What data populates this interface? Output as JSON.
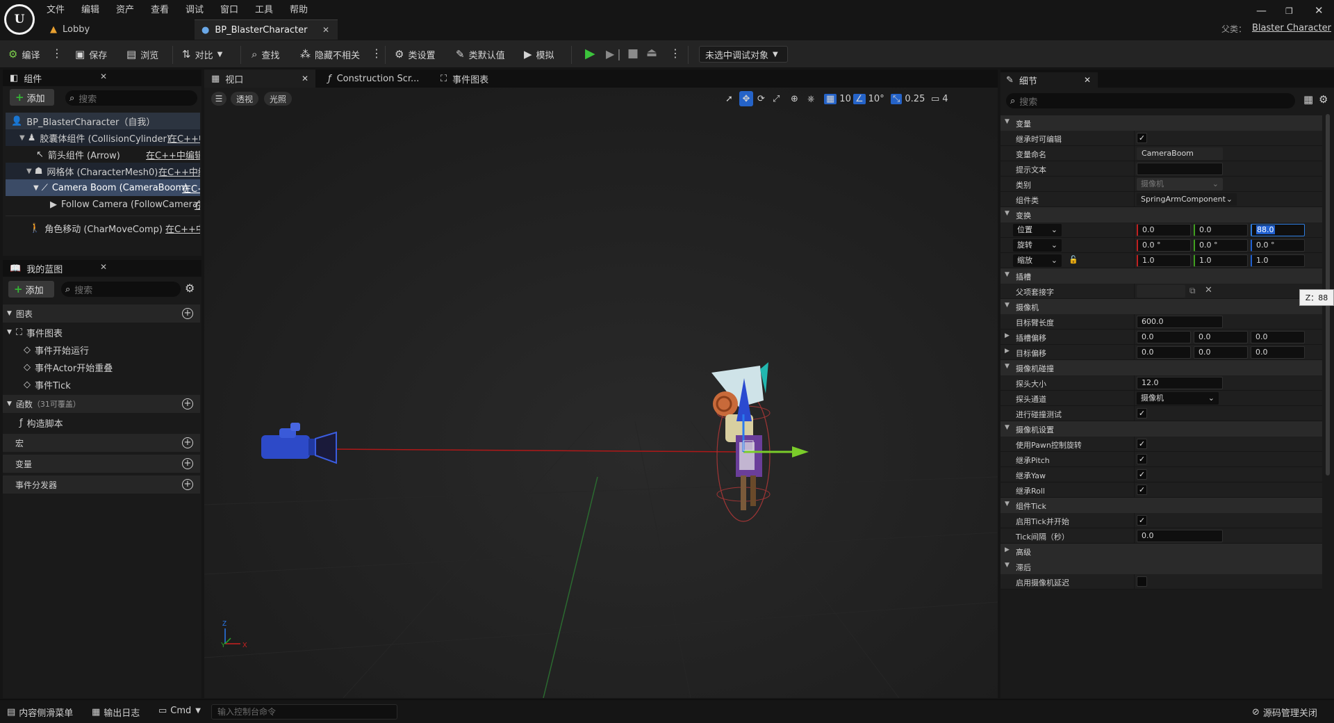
{
  "menu": [
    "文件",
    "编辑",
    "资产",
    "查看",
    "调试",
    "窗口",
    "工具",
    "帮助"
  ],
  "window_controls": {
    "minimize": "—",
    "restore": "❐",
    "close": "✕"
  },
  "tabs": [
    {
      "label": "Lobby"
    },
    {
      "label": "BP_BlasterCharacter"
    }
  ],
  "parent_class": {
    "label": "父类：",
    "value": "Blaster Character"
  },
  "toolbar": {
    "compile": "编译",
    "save": "保存",
    "browse": "浏览",
    "diff": "对比",
    "find": "查找",
    "hide_unrelated": "隐藏不相关",
    "class_settings": "类设置",
    "class_defaults": "类默认值",
    "simulate": "模拟",
    "debug_target": "未选中调试对象"
  },
  "components": {
    "title": "组件",
    "add": "添加",
    "search_placeholder": "搜索",
    "items": [
      {
        "label": "BP_BlasterCharacter（自我）"
      },
      {
        "label": "胶囊体组件 (CollisionCylinder)",
        "link": "在C++中"
      },
      {
        "label": "箭头组件 (Arrow)",
        "link": "在C++中编辑"
      },
      {
        "label": "网格体 (CharacterMesh0)",
        "link": "在C++中编"
      },
      {
        "label": "Camera Boom (CameraBoom)",
        "link": "在C+"
      },
      {
        "label": "Follow Camera (FollowCamera)",
        "link": "在"
      },
      {
        "label": "角色移动 (CharMoveComp)",
        "link": "在C++中编"
      }
    ]
  },
  "my_blueprint": {
    "title": "我的蓝图",
    "add": "添加",
    "search_placeholder": "搜索",
    "graphs": "图表",
    "event_graph": "事件图表",
    "events": [
      "事件开始运行",
      "事件Actor开始重叠",
      "事件Tick"
    ],
    "functions": "函数",
    "functions_note": "（31可覆盖）",
    "construction": "构造脚本",
    "macros": "宏",
    "variables": "变量",
    "dispatchers": "事件分发器"
  },
  "viewport": {
    "tabs": [
      {
        "label": "视口"
      },
      {
        "label": "Construction Scr..."
      },
      {
        "label": "事件图表"
      }
    ],
    "perspective": "透视",
    "lit": "光照",
    "grid_snap": "10",
    "rot_snap": "10°",
    "scale_snap": "0.25",
    "cam_speed": "4"
  },
  "details": {
    "title": "细节",
    "search_placeholder": "搜索",
    "cat_variable": "变量",
    "editable_when_inherited": "继承时可编辑",
    "editable_checked": true,
    "variable_name_label": "变量命名",
    "variable_name": "CameraBoom",
    "tooltip_label": "提示文本",
    "tooltip": "",
    "category_label": "类别",
    "category": "摄像机",
    "component_class_label": "组件类",
    "component_class": "SpringArmComponent",
    "cat_transform": "变换",
    "location": {
      "label": "位置",
      "x": "0.0",
      "y": "0.0",
      "z": "88.0"
    },
    "rotation": {
      "label": "旋转",
      "x": "0.0 °",
      "y": "0.0 °",
      "z": "0.0 °"
    },
    "scale": {
      "label": "缩放",
      "x": "1.0",
      "y": "1.0",
      "z": "1.0"
    },
    "tooltip_z": "Z：88",
    "cat_socket": "插槽",
    "parent_socket": "父项套接字",
    "cat_camera": "摄像机",
    "target_arm_length_label": "目标臂长度",
    "target_arm_length": "600.0",
    "socket_offset": {
      "label": "插槽偏移",
      "x": "0.0",
      "y": "0.0",
      "z": "0.0"
    },
    "target_offset": {
      "label": "目标偏移",
      "x": "0.0",
      "y": "0.0",
      "z": "0.0"
    },
    "cat_camera_collision": "摄像机碰撞",
    "probe_size_label": "探头大小",
    "probe_size": "12.0",
    "probe_channel_label": "探头通道",
    "probe_channel": "摄像机",
    "do_collision_test": "进行碰撞测试",
    "cat_camera_settings": "摄像机设置",
    "use_pawn_control_rotation": "使用Pawn控制旋转",
    "inherit_pitch": "继承Pitch",
    "inherit_yaw": "继承Yaw",
    "inherit_roll": "继承Roll",
    "cat_component_tick": "组件Tick",
    "start_with_tick": "启用Tick并开始",
    "tick_interval_label": "Tick间隔（秒）",
    "tick_interval": "0.0",
    "cat_advanced": "高级",
    "cat_lag": "滞后",
    "enable_camera_lag": "启用摄像机延迟"
  },
  "statusbar": {
    "content_drawer": "内容侧滑菜单",
    "output_log": "输出日志",
    "cmd": "Cmd",
    "console_placeholder": "输入控制台命令",
    "source_control": "源码管理关闭"
  }
}
